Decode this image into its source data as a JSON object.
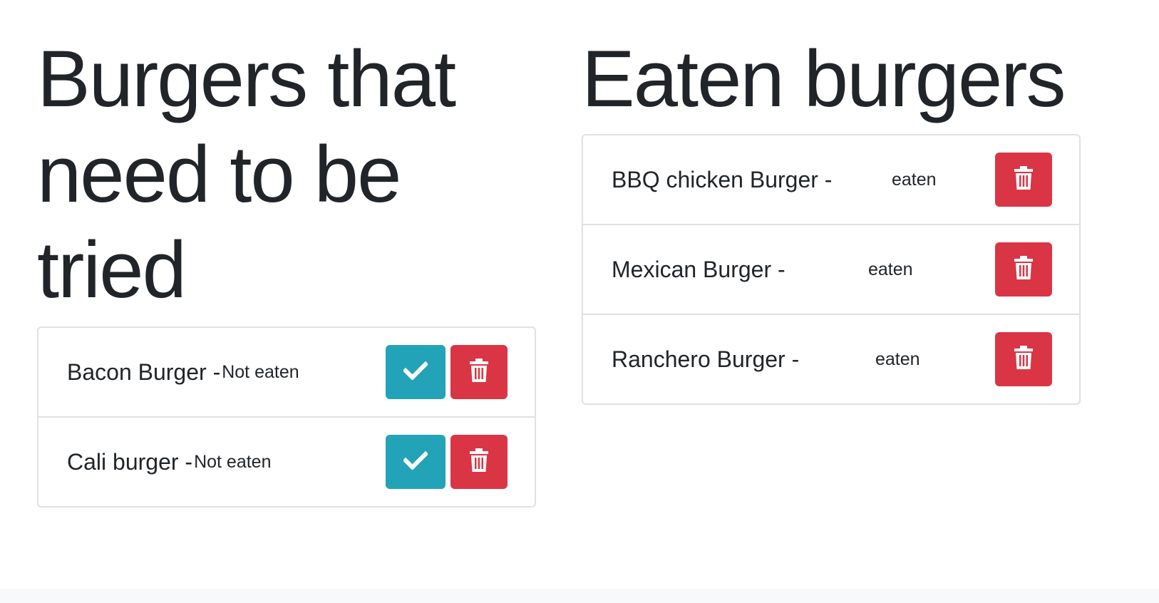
{
  "untried": {
    "heading": "Burgers that need to be tried",
    "items": [
      {
        "name": "Bacon Burger -",
        "status": "Not eaten"
      },
      {
        "name": "Cali burger -",
        "status": "Not eaten"
      }
    ]
  },
  "eaten": {
    "heading": "Eaten burgers",
    "items": [
      {
        "name": "BBQ chicken Burger -",
        "status": "eaten"
      },
      {
        "name": "Mexican Burger -",
        "status": "eaten"
      },
      {
        "name": "Ranchero Burger -",
        "status": "eaten"
      }
    ]
  },
  "icons": {
    "devour": "check-icon",
    "delete": "trash-icon"
  },
  "colors": {
    "devour_button": "#23a3b8",
    "delete_button": "#da3545",
    "text": "#212529",
    "border": "#dfe1e4"
  }
}
